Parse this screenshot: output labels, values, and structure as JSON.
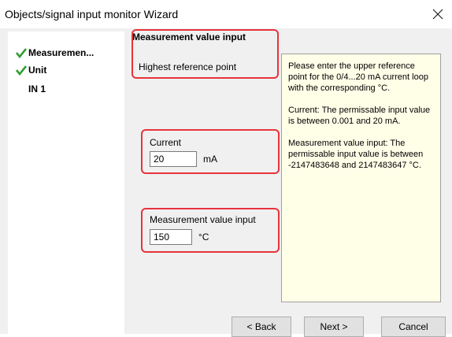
{
  "window": {
    "title": "Objects/signal input monitor Wizard",
    "close_icon": "close-icon"
  },
  "steps": [
    {
      "label": "Measuremen...",
      "done": true
    },
    {
      "label": "Unit",
      "done": true
    },
    {
      "label": "IN 1",
      "done": false
    }
  ],
  "panel": {
    "title": "Measurement value input",
    "subtitle": "Highest reference point"
  },
  "current": {
    "label": "Current",
    "value": "20",
    "unit": "mA"
  },
  "measurement": {
    "label": "Measurement value input",
    "value": "150",
    "unit": "°C"
  },
  "help": {
    "p1": "Please enter the upper reference point for the 0/4...20 mA current loop with the corresponding °C.",
    "p2": "Current: The permissable input value is between 0.001 and 20 mA.",
    "p3": "Measurement value input: The permissable input value is between -2147483648 and 2147483647 °C."
  },
  "buttons": {
    "back": "< Back",
    "next": "Next >",
    "cancel": "Cancel"
  },
  "colors": {
    "highlight": "#e8323c",
    "check": "#2e9e2e",
    "help_bg": "#ffffe8"
  }
}
